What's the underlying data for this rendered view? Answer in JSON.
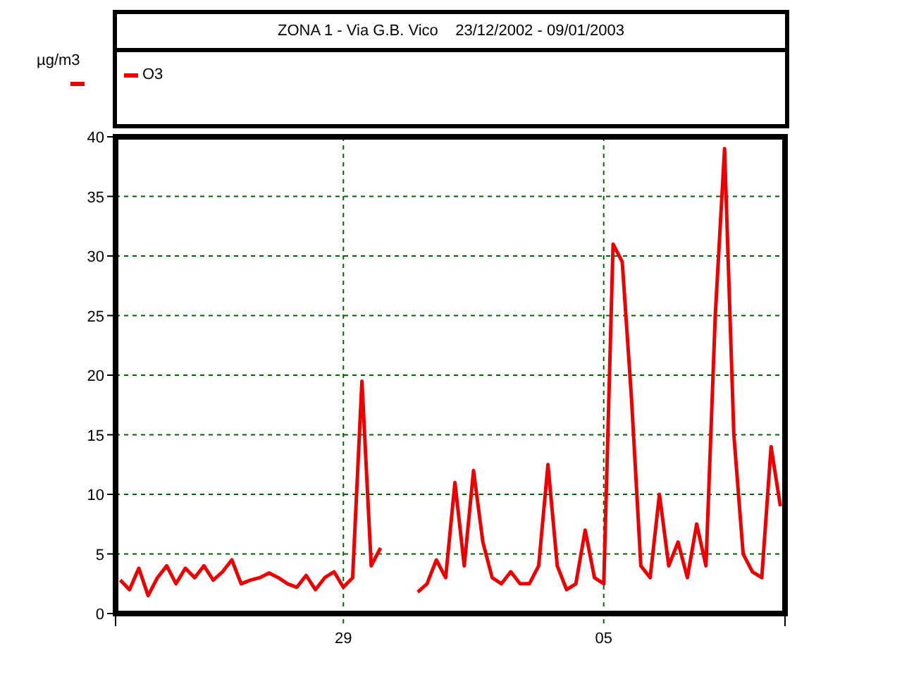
{
  "title": "ZONA 1 - Via G.B. Vico    23/12/2002 - 09/01/2003",
  "chart_data": {
    "type": "line",
    "ylabel": "µg/m3",
    "ylim": [
      0,
      40
    ],
    "grid": true,
    "yticks": [
      0,
      5,
      10,
      15,
      20,
      25,
      30,
      35,
      40
    ],
    "categories": [
      null,
      null,
      null,
      null,
      null,
      null,
      null,
      null,
      null,
      null,
      null,
      null,
      null,
      null,
      null,
      null,
      null,
      null,
      null,
      null,
      null,
      null,
      null,
      null,
      "29",
      null,
      null,
      null,
      null,
      null,
      null,
      null,
      null,
      null,
      null,
      null,
      null,
      null,
      null,
      null,
      null,
      null,
      null,
      null,
      null,
      null,
      null,
      null,
      null,
      null,
      null,
      null,
      "05",
      null,
      null,
      null,
      null,
      null,
      null,
      null,
      null,
      null,
      null,
      null,
      null,
      null,
      null,
      null,
      null,
      null,
      null,
      null
    ],
    "series": [
      {
        "name": "O3",
        "color": "#ee0000",
        "values": [
          2.8,
          2.0,
          3.8,
          1.5,
          3,
          4,
          2.5,
          3.8,
          3,
          4,
          2.8,
          3.5,
          4.5,
          2.5,
          2.8,
          3,
          3.4,
          3,
          2.5,
          2.2,
          3.2,
          2,
          3,
          3.5,
          2.2,
          3,
          19.5,
          4,
          5.5,
          null,
          null,
          null,
          1.8,
          2.5,
          4.5,
          3,
          11,
          4,
          12,
          6,
          3,
          2.5,
          3.5,
          2.5,
          2.5,
          4,
          12.5,
          4,
          2,
          2.5,
          7,
          3,
          2.5,
          31,
          29.5,
          18,
          4,
          3,
          10,
          4,
          6,
          3,
          7.5,
          4,
          25,
          39,
          15,
          5,
          3.5,
          3,
          14,
          9
        ]
      }
    ]
  }
}
